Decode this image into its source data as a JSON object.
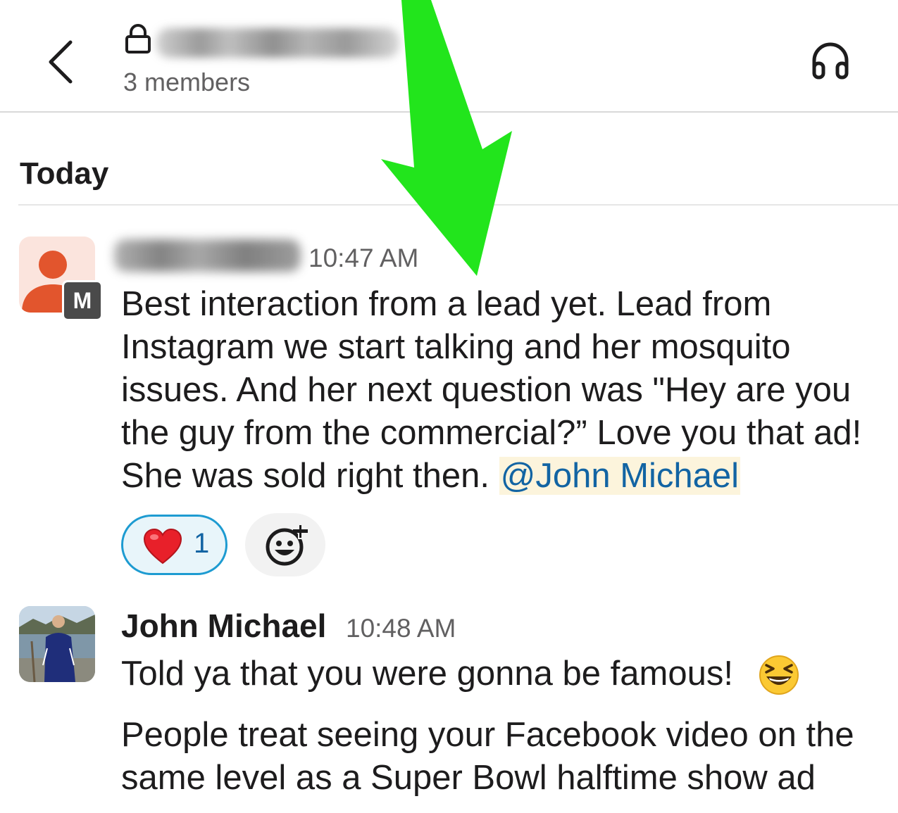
{
  "header": {
    "members": "3 members"
  },
  "day_divider": {
    "label": "Today"
  },
  "messages": [
    {
      "avatar_badge": "M",
      "time": "10:47 AM",
      "text": "Best interaction from a lead yet. Lead from Instagram we start talking and her mosquito issues. And her next question was \"Hey are you the guy from the commercial?” Love you that ad! She was sold right then. ",
      "mention": "@John Michael",
      "reactions": [
        {
          "emoji": "heart-emoji",
          "count": "1"
        }
      ],
      "add_reaction_icon": "add-emoji-icon"
    },
    {
      "sender": "John Michael",
      "time": "10:48 AM",
      "text_line_1": "Told ya that you were gonna be famous!",
      "emoji": "laughing-squint-emoji",
      "text_paragraph_2": "People treat seeing your Facebook video on the same level as a Super Bowl halftime show ad"
    }
  ],
  "colors": {
    "annotation_arrow": "#22e51c",
    "mention_text": "#1264a3",
    "mention_bg": "#fcf4dc",
    "reaction_border": "#1d9bd1",
    "avatar_orange": "#e2552d"
  }
}
